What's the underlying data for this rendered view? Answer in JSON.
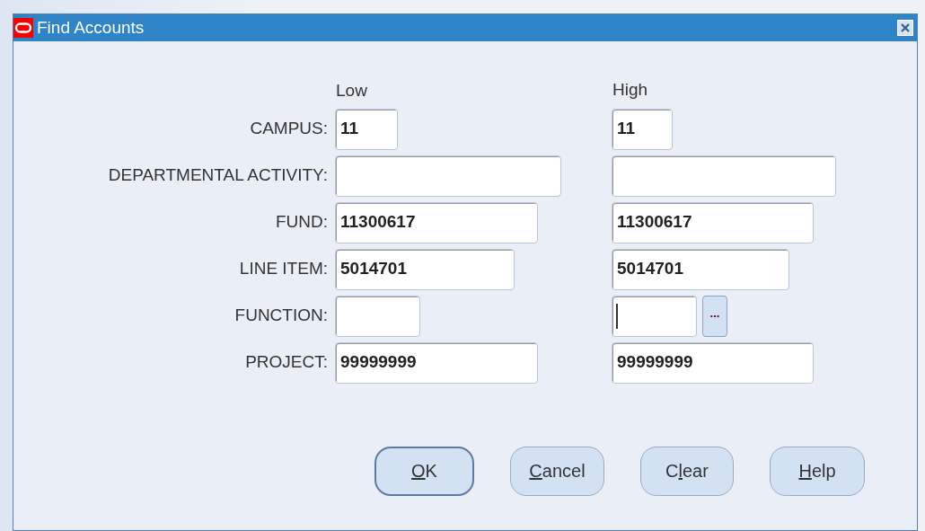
{
  "window": {
    "title": "Find Accounts"
  },
  "columns": [
    "Low",
    "High"
  ],
  "rows": [
    {
      "label": "CAMPUS:",
      "low": {
        "value": "11",
        "focused": false
      },
      "high": {
        "value": "11",
        "focused": false
      }
    },
    {
      "label": "DEPARTMENTAL ACTIVITY:",
      "low": {
        "focused": false
      },
      "high": {
        "focused": false
      }
    },
    {
      "label": "FUND:",
      "low": {
        "value": "11300617",
        "focused": false
      },
      "high": {
        "value": "11300617",
        "focused": false
      }
    },
    {
      "label": "LINE ITEM:",
      "low": {
        "value": "5014701",
        "focused": false
      },
      "high": {
        "value": "5014701",
        "focused": false
      }
    },
    {
      "label": "FUNCTION:",
      "low": {
        "focused": false
      },
      "high": {
        "focused": true,
        "list_button": "..."
      }
    },
    {
      "label": "PROJECT:",
      "low": {
        "value": "99999999",
        "focused": false
      },
      "high": {
        "value": "99999999",
        "focused": false
      }
    }
  ],
  "buttons": [
    {
      "mnemonic": "O",
      "label_rest": "K",
      "default": true
    },
    {
      "mnemonic": "C",
      "label_rest": "ancel",
      "default": false
    },
    {
      "label_start": "C",
      "mnemonic": "l",
      "label_rest": "ear",
      "default": false
    },
    {
      "mnemonic": "H",
      "label_rest": "elp",
      "default": false
    }
  ]
}
